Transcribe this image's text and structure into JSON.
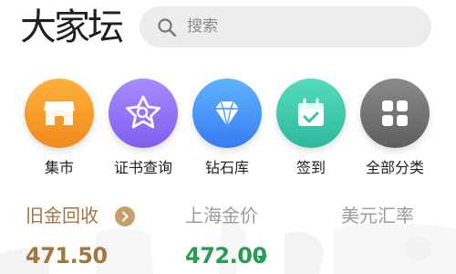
{
  "header": {
    "logo_text": "大家坛",
    "search": {
      "placeholder": "搜索",
      "icon": "search-icon"
    }
  },
  "quick_entries": [
    {
      "label": "集市",
      "icon": "storefront-icon",
      "color": "#f5962a"
    },
    {
      "label": "证书查询",
      "icon": "star-search-icon",
      "color": "#8e6df0"
    },
    {
      "label": "钻石库",
      "icon": "diamond-icon",
      "color": "#3f8ff5"
    },
    {
      "label": "签到",
      "icon": "calendar-check-icon",
      "color": "#39c9aa"
    },
    {
      "label": "全部分类",
      "icon": "grid-icon",
      "color": "#707070"
    }
  ],
  "price_tabs": [
    {
      "label": "旧金回收",
      "value": "471.50",
      "active": true,
      "color": "#a3753f",
      "more_icon": "chevron-right-circle-icon"
    },
    {
      "label": "上海金价",
      "value": "472.00",
      "active": false,
      "color": "#2a9b53",
      "trend_icon": "down-triangle-icon"
    },
    {
      "label": "美元汇率",
      "active": false
    }
  ]
}
